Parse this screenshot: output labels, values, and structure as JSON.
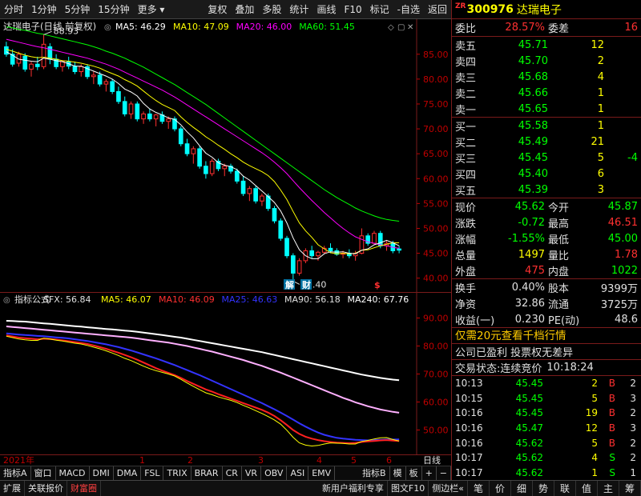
{
  "toolbar": {
    "left": [
      "分时",
      "1分钟",
      "5分钟",
      "15分钟",
      "更多"
    ],
    "right": [
      "复权",
      "叠加",
      "多股",
      "统计",
      "画线",
      "F10",
      "标记",
      "-自选",
      "返回"
    ]
  },
  "main_chart": {
    "title": "达瑞电子(日线,前复权)",
    "legend": [
      {
        "label": "MA5: 46.29",
        "color": "#ffffff"
      },
      {
        "label": "MA10: 47.09",
        "color": "#ffff00"
      },
      {
        "label": "MA20: 46.00",
        "color": "#ff00ff"
      },
      {
        "label": "MA60: 51.45",
        "color": "#00ff00"
      }
    ],
    "y_ticks": [
      85,
      80,
      75,
      70,
      65,
      60,
      55,
      50,
      45,
      40
    ],
    "ylim": [
      38.5,
      88.5
    ],
    "high_label": "88.93",
    "low_label": "39.40",
    "markers": [
      "解",
      "财",
      "$"
    ]
  },
  "sub_chart": {
    "legend": [
      {
        "label": "指标公式",
        "color": "#e0e0e0"
      },
      {
        "label": "SFX: 56.84",
        "color": "#e0e0e0"
      },
      {
        "label": "MA5: 46.07",
        "color": "#ffff00"
      },
      {
        "label": "MA10: 46.09",
        "color": "#ff3030"
      },
      {
        "label": "MA25: 46.63",
        "color": "#3333ff"
      },
      {
        "label": "MA90: 56.18",
        "color": "#e0e0e0"
      },
      {
        "label": "MA240: 67.76",
        "color": "#ffffff"
      }
    ],
    "y_ticks": [
      90,
      80,
      70,
      60,
      50
    ],
    "ylim": [
      43,
      95
    ]
  },
  "x_axis": {
    "labels": [
      "2021年",
      "1",
      "2",
      "3",
      "4",
      "5",
      "6"
    ],
    "right_label": "日线"
  },
  "bottom_tabs": [
    "指标A",
    "窗口",
    "MACD",
    "DMI",
    "DMA",
    "FSL",
    "TRIX",
    "BRAR",
    "CR",
    "VR",
    "OBV",
    "ASI",
    "EMV",
    "指标B",
    "模",
    "板",
    "+",
    "−"
  ],
  "status_bar": {
    "left": [
      "扩展",
      "关联报价",
      "财富圈"
    ],
    "right": [
      "新用户福利专享",
      "图文F10",
      "侧边栏«"
    ],
    "icons": [
      "笔",
      "价",
      "细",
      "势",
      "联",
      "值",
      "主",
      "筹"
    ]
  },
  "quote": {
    "tag": "ZR",
    "code": "300976",
    "name": "达瑞电子",
    "weibi_label": "委比",
    "weibi_value": "28.57%",
    "weicha_label": "委差",
    "weicha_value": "16",
    "asks": [
      {
        "label": "卖五",
        "price": "45.71",
        "vol": "12"
      },
      {
        "label": "卖四",
        "price": "45.70",
        "vol": "2"
      },
      {
        "label": "卖三",
        "price": "45.68",
        "vol": "4"
      },
      {
        "label": "卖二",
        "price": "45.66",
        "vol": "1"
      },
      {
        "label": "卖一",
        "price": "45.65",
        "vol": "1"
      }
    ],
    "bids": [
      {
        "label": "买一",
        "price": "45.58",
        "vol": "1",
        "chg": ""
      },
      {
        "label": "买二",
        "price": "45.49",
        "vol": "21",
        "chg": ""
      },
      {
        "label": "买三",
        "price": "45.45",
        "vol": "5",
        "chg": "-4"
      },
      {
        "label": "买四",
        "price": "45.40",
        "vol": "6",
        "chg": ""
      },
      {
        "label": "买五",
        "price": "45.39",
        "vol": "3",
        "chg": ""
      }
    ],
    "stats": [
      {
        "l1": "现价",
        "v1": "45.62",
        "c1": "#00ff00",
        "l2": "今开",
        "v2": "45.87",
        "c2": "#00ff00"
      },
      {
        "l1": "涨跌",
        "v1": "-0.72",
        "c1": "#00ff00",
        "l2": "最高",
        "v2": "46.51",
        "c2": "#ff3030"
      },
      {
        "l1": "涨幅",
        "v1": "-1.55%",
        "c1": "#00ff00",
        "l2": "最低",
        "v2": "45.00",
        "c2": "#00ff00"
      },
      {
        "l1": "总量",
        "v1": "1497",
        "c1": "#ffff00",
        "l2": "量比",
        "v2": "1.78",
        "c2": "#ff3030"
      },
      {
        "l1": "外盘",
        "v1": "475",
        "c1": "#ff3030",
        "l2": "内盘",
        "v2": "1022",
        "c2": "#00ff00"
      }
    ],
    "stats2": [
      {
        "l1": "换手",
        "v1": "0.40%",
        "l2": "股本",
        "v2": "9399万"
      },
      {
        "l1": "净资",
        "v1": "32.86",
        "l2": "流通",
        "v2": "3725万"
      },
      {
        "l1": "收益(一)",
        "v1": "0.230",
        "l2": "PE(动)",
        "v2": "48.6"
      }
    ],
    "ad_text": "仅需20元查看千档行情",
    "notice": "公司已盈利 投票权无差异",
    "trade_state_label": "交易状态:",
    "trade_state": "连续竞价",
    "trade_time": "10:18:24",
    "ticks": [
      {
        "time": "10:13",
        "price": "45.45",
        "vol": "2",
        "side": "B",
        "n": "2"
      },
      {
        "time": "10:15",
        "price": "45.45",
        "vol": "5",
        "side": "B",
        "n": "3"
      },
      {
        "time": "10:16",
        "price": "45.45",
        "vol": "19",
        "side": "B",
        "n": "2"
      },
      {
        "time": "10:16",
        "price": "45.47",
        "vol": "12",
        "side": "B",
        "n": "3"
      },
      {
        "time": "10:16",
        "price": "45.62",
        "vol": "5",
        "side": "B",
        "n": "2"
      },
      {
        "time": "10:17",
        "price": "45.62",
        "vol": "4",
        "side": "S",
        "n": "2"
      },
      {
        "time": "10:17",
        "price": "45.62",
        "vol": "1",
        "side": "S",
        "n": "1"
      }
    ]
  },
  "chart_data": {
    "type": "candlestick",
    "title": "达瑞电子(日线,前复权)",
    "ylim": [
      38.5,
      88.5
    ],
    "candles": [
      [
        86.5,
        87.5,
        84.5,
        85.0
      ],
      [
        85.0,
        86.0,
        82.5,
        83.0
      ],
      [
        83.2,
        85.5,
        82.5,
        85.0
      ],
      [
        84.6,
        85.2,
        81.5,
        82.0
      ],
      [
        82.0,
        83.5,
        80.5,
        83.0
      ],
      [
        83.0,
        84.5,
        81.8,
        82.5
      ],
      [
        82.5,
        88.93,
        82.0,
        87.0
      ],
      [
        86.5,
        87.2,
        83.0,
        84.0
      ],
      [
        84.0,
        85.0,
        82.0,
        82.5
      ],
      [
        82.5,
        83.8,
        81.5,
        83.5
      ],
      [
        83.5,
        84.5,
        82.0,
        82.6
      ],
      [
        82.6,
        83.5,
        81.0,
        81.5
      ],
      [
        81.5,
        83.0,
        80.5,
        82.5
      ],
      [
        82.5,
        83.0,
        80.0,
        80.5
      ],
      [
        80.5,
        81.5,
        79.0,
        80.8
      ],
      [
        80.8,
        81.5,
        78.5,
        79.0
      ],
      [
        79.0,
        80.0,
        77.5,
        79.5
      ],
      [
        79.5,
        80.0,
        77.0,
        77.5
      ],
      [
        77.5,
        78.5,
        75.0,
        75.5
      ],
      [
        75.5,
        76.5,
        72.5,
        73.0
      ],
      [
        73.0,
        75.5,
        72.0,
        75.0
      ],
      [
        75.0,
        75.5,
        71.5,
        72.0
      ],
      [
        72.0,
        73.5,
        71.0,
        73.0
      ],
      [
        73.0,
        74.0,
        71.5,
        72.0
      ],
      [
        72.0,
        73.0,
        70.5,
        72.8
      ],
      [
        72.8,
        73.5,
        71.0,
        71.5
      ],
      [
        71.5,
        72.5,
        70.0,
        72.0
      ],
      [
        72.0,
        72.5,
        69.5,
        70.0
      ],
      [
        70.0,
        70.5,
        66.5,
        67.0
      ],
      [
        67.0,
        68.0,
        64.5,
        65.0
      ],
      [
        65.0,
        66.5,
        63.0,
        66.0
      ],
      [
        66.0,
        66.5,
        62.0,
        62.5
      ],
      [
        62.5,
        63.5,
        60.0,
        61.0
      ],
      [
        61.0,
        64.0,
        60.5,
        63.5
      ],
      [
        63.5,
        64.0,
        61.5,
        62.0
      ],
      [
        62.0,
        63.0,
        60.5,
        62.5
      ],
      [
        62.5,
        63.0,
        61.0,
        61.5
      ],
      [
        61.5,
        62.0,
        59.0,
        59.5
      ],
      [
        59.5,
        60.5,
        56.5,
        57.0
      ],
      [
        57.0,
        58.5,
        55.5,
        58.0
      ],
      [
        58.0,
        58.5,
        55.0,
        55.5
      ],
      [
        55.5,
        57.0,
        54.5,
        56.5
      ],
      [
        56.5,
        57.0,
        53.5,
        54.0
      ],
      [
        54.0,
        54.5,
        51.0,
        51.5
      ],
      [
        51.5,
        52.0,
        47.5,
        48.0
      ],
      [
        48.0,
        48.5,
        44.0,
        44.5
      ],
      [
        44.5,
        45.0,
        39.4,
        41.0
      ],
      [
        41.0,
        44.0,
        40.5,
        43.5
      ],
      [
        43.5,
        46.0,
        43.0,
        45.5
      ],
      [
        45.5,
        46.5,
        44.0,
        44.5
      ],
      [
        44.5,
        45.5,
        43.5,
        45.2
      ],
      [
        45.2,
        46.5,
        44.8,
        46.0
      ],
      [
        46.0,
        47.0,
        45.0,
        45.5
      ],
      [
        45.5,
        46.0,
        44.5,
        44.8
      ],
      [
        44.8,
        45.5,
        44.0,
        45.0
      ],
      [
        45.0,
        45.8,
        44.0,
        44.5
      ],
      [
        44.5,
        45.5,
        43.5,
        45.0
      ],
      [
        45.0,
        50.0,
        44.8,
        48.5
      ],
      [
        48.5,
        49.0,
        46.5,
        47.0
      ],
      [
        47.0,
        49.5,
        46.8,
        49.0
      ],
      [
        49.0,
        49.5,
        46.0,
        46.5
      ],
      [
        46.5,
        47.5,
        45.5,
        47.0
      ],
      [
        47.0,
        47.5,
        45.0,
        45.5
      ],
      [
        45.87,
        46.51,
        45.0,
        45.62
      ]
    ],
    "ma5": [
      85.5,
      84.8,
      84.0,
      83.8,
      83.6,
      83.5,
      84.2,
      84.0,
      83.7,
      83.5,
      83.1,
      82.6,
      82.6,
      82.1,
      81.6,
      81.1,
      80.6,
      80.0,
      79.1,
      78.0,
      77.4,
      76.6,
      75.1,
      74.0,
      73.3,
      72.8,
      72.2,
      71.9,
      70.8,
      69.4,
      68.2,
      66.6,
      65.1,
      64.3,
      63.2,
      62.7,
      62.4,
      61.8,
      60.5,
      59.7,
      58.6,
      57.5,
      56.4,
      55.2,
      53.5,
      51.1,
      48.1,
      45.7,
      44.5,
      43.9,
      43.9,
      44.9,
      45.3,
      45.2,
      45.3,
      45.0,
      44.9,
      45.6,
      45.9,
      46.7,
      47.1,
      47.6,
      47.1,
      46.5
    ],
    "ma10": [
      86.0,
      85.6,
      85.2,
      84.8,
      84.5,
      84.3,
      84.4,
      84.2,
      84.0,
      83.7,
      83.6,
      83.4,
      83.2,
      82.9,
      82.6,
      82.2,
      81.6,
      81.1,
      80.6,
      79.9,
      79.3,
      78.6,
      77.6,
      76.6,
      75.7,
      74.9,
      74.3,
      73.7,
      72.4,
      71.3,
      70.3,
      69.4,
      68.4,
      67.6,
      66.7,
      65.9,
      65.0,
      64.2,
      63.3,
      62.6,
      62.0,
      61.4,
      60.6,
      59.4,
      57.7,
      55.8,
      53.4,
      51.1,
      49.5,
      48.2,
      46.7,
      45.9,
      45.1,
      44.9,
      45.0,
      44.9,
      45.0,
      45.6,
      45.7,
      46.1,
      46.5,
      46.8,
      47.1,
      47.1
    ],
    "ma20": [
      88.0,
      87.7,
      87.4,
      87.1,
      86.8,
      86.5,
      86.3,
      86.0,
      85.7,
      85.4,
      85.1,
      84.8,
      84.5,
      84.2,
      83.8,
      83.4,
      83.0,
      82.5,
      82.0,
      81.4,
      80.8,
      80.2,
      79.6,
      79.0,
      78.4,
      77.8,
      77.1,
      76.4,
      75.6,
      74.8,
      74.0,
      73.2,
      72.4,
      71.6,
      70.8,
      70.0,
      69.2,
      68.4,
      67.6,
      66.8,
      66.0,
      65.2,
      64.3,
      63.3,
      62.2,
      61.0,
      59.6,
      58.2,
      56.9,
      55.6,
      54.4,
      53.2,
      52.1,
      51.0,
      50.0,
      49.1,
      48.3,
      47.8,
      47.3,
      47.0,
      46.7,
      46.5,
      46.2,
      46.0
    ],
    "ma60": [
      90.5,
      90.3,
      90.0,
      89.8,
      89.5,
      89.2,
      89.0,
      88.7,
      88.4,
      88.1,
      87.8,
      87.5,
      87.2,
      86.9,
      86.5,
      86.1,
      85.6,
      85.2,
      84.7,
      84.2,
      83.6,
      83.0,
      82.4,
      81.7,
      81.0,
      80.3,
      79.6,
      78.9,
      78.1,
      77.3,
      76.5,
      75.7,
      74.9,
      74.0,
      73.1,
      72.2,
      71.3,
      70.4,
      69.5,
      68.6,
      67.7,
      66.8,
      65.9,
      65.0,
      64.1,
      63.2,
      62.3,
      61.4,
      60.5,
      59.6,
      58.7,
      57.8,
      57.0,
      56.2,
      55.5,
      54.8,
      54.1,
      53.5,
      53.0,
      52.5,
      52.1,
      51.8,
      51.6,
      51.45
    ],
    "sub": {
      "ylim": [
        43,
        95
      ],
      "ma240": [
        89.0,
        88.9,
        88.8,
        88.7,
        88.5,
        88.3,
        88.1,
        87.9,
        87.7,
        87.5,
        87.3,
        87.1,
        86.9,
        86.7,
        86.5,
        86.3,
        86.1,
        85.9,
        85.7,
        85.5,
        85.3,
        85.1,
        84.8,
        84.5,
        84.2,
        83.9,
        83.6,
        83.3,
        83.0,
        82.6,
        82.2,
        81.8,
        81.4,
        81.0,
        80.6,
        80.2,
        79.8,
        79.4,
        79.0,
        78.6,
        78.2,
        77.8,
        77.3,
        76.8,
        76.3,
        75.8,
        75.3,
        74.8,
        74.3,
        73.8,
        73.3,
        72.8,
        72.3,
        71.8,
        71.3,
        70.8,
        70.3,
        69.8,
        69.4,
        69.0,
        68.6,
        68.3,
        68.0,
        67.76
      ],
      "ma90": [
        87.0,
        86.8,
        86.6,
        86.4,
        86.2,
        86.0,
        85.8,
        85.6,
        85.4,
        85.2,
        85.0,
        84.8,
        84.6,
        84.4,
        84.2,
        84.0,
        83.8,
        83.6,
        83.4,
        83.2,
        83.0,
        82.7,
        82.4,
        82.1,
        81.8,
        81.5,
        81.2,
        80.8,
        80.4,
        80.0,
        79.5,
        79.0,
        78.5,
        78.0,
        77.4,
        76.8,
        76.2,
        75.6,
        75.0,
        74.3,
        73.6,
        72.9,
        72.1,
        71.3,
        70.5,
        69.6,
        68.7,
        67.8,
        66.9,
        66.0,
        65.1,
        64.2,
        63.3,
        62.4,
        61.5,
        60.7,
        59.9,
        59.2,
        58.5,
        57.9,
        57.3,
        56.9,
        56.5,
        56.18
      ],
      "ma25": [
        84.5,
        84.3,
        84.1,
        83.9,
        83.8,
        83.6,
        83.5,
        83.3,
        83.1,
        82.9,
        82.7,
        82.4,
        82.1,
        81.8,
        81.4,
        81.0,
        80.6,
        80.1,
        79.6,
        79.0,
        78.4,
        77.7,
        77.0,
        76.3,
        75.6,
        74.8,
        74.0,
        73.2,
        72.3,
        71.4,
        70.5,
        69.6,
        68.6,
        67.6,
        66.6,
        65.6,
        64.6,
        63.6,
        62.6,
        61.6,
        60.6,
        59.6,
        58.5,
        57.4,
        56.2,
        55.0,
        53.7,
        52.4,
        51.2,
        50.1,
        49.1,
        48.3,
        47.7,
        47.2,
        46.9,
        46.7,
        46.5,
        46.4,
        46.3,
        46.4,
        46.5,
        46.6,
        46.6,
        46.63
      ],
      "ma10": [
        83.8,
        83.4,
        83.0,
        82.8,
        82.6,
        82.4,
        82.6,
        82.5,
        82.3,
        82.0,
        81.7,
        81.4,
        81.1,
        80.7,
        80.2,
        79.6,
        79.0,
        78.3,
        77.6,
        76.8,
        76.0,
        75.1,
        74.1,
        73.1,
        72.1,
        71.2,
        70.4,
        69.6,
        68.6,
        67.5,
        66.5,
        65.5,
        64.5,
        63.7,
        62.8,
        62.0,
        61.2,
        60.4,
        59.6,
        58.8,
        58.0,
        57.2,
        56.2,
        55.0,
        53.5,
        51.8,
        50.0,
        48.6,
        47.6,
        46.9,
        46.4,
        46.0,
        45.7,
        45.5,
        45.4,
        45.3,
        45.4,
        45.7,
        45.9,
        46.1,
        46.3,
        46.4,
        46.2,
        46.09
      ],
      "ma5": [
        83.5,
        83.0,
        82.5,
        82.2,
        82.0,
        82.0,
        82.8,
        82.5,
        82.1,
        81.8,
        81.4,
        81.0,
        80.7,
        80.2,
        79.6,
        79.0,
        78.3,
        77.5,
        76.6,
        75.6,
        74.8,
        73.8,
        72.8,
        71.9,
        71.2,
        70.6,
        70.0,
        69.3,
        68.1,
        66.8,
        65.6,
        64.4,
        63.3,
        62.6,
        61.8,
        61.2,
        60.6,
        59.8,
        58.8,
        57.9,
        56.9,
        55.9,
        54.8,
        53.6,
        52.1,
        49.9,
        47.4,
        45.4,
        44.6,
        44.3,
        44.5,
        45.0,
        45.4,
        45.3,
        45.2,
        45.0,
        45.0,
        45.9,
        46.3,
        46.8,
        47.2,
        47.3,
        46.6,
        46.07
      ]
    }
  }
}
